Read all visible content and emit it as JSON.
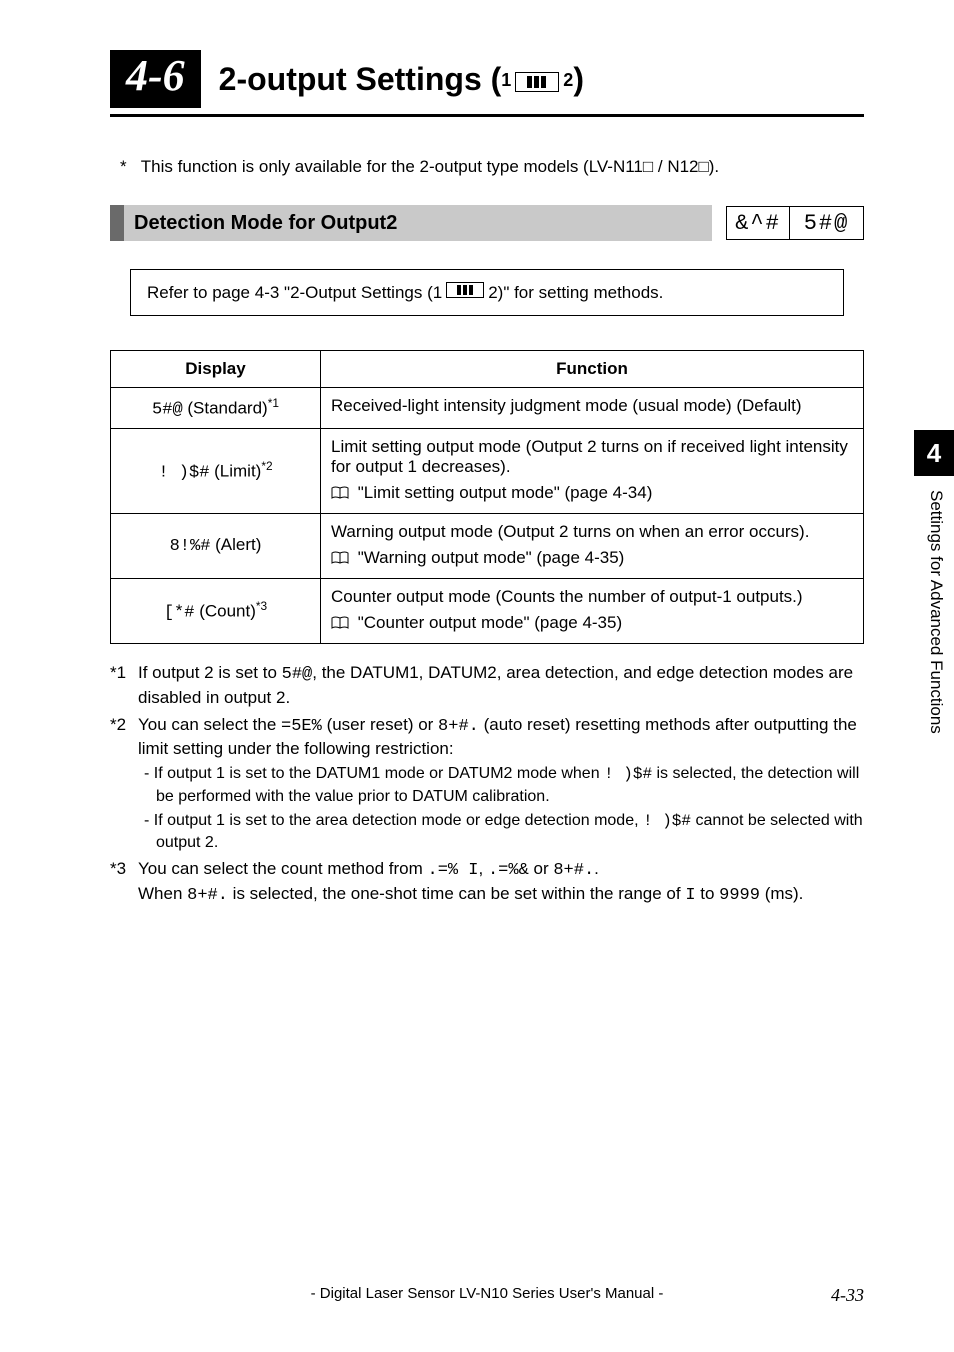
{
  "section": {
    "number": "4-6",
    "title_a": "2-output Settings (",
    "title_b": ")"
  },
  "bullets_label": {
    "left": "1",
    "right": "2"
  },
  "top_note": {
    "star": "*",
    "text": "This function is only available for the 2-output type models (LV-N11□ / N12□)."
  },
  "subheader": "Detection Mode for Output2",
  "seg": {
    "left": "&^#",
    "right": "5#@"
  },
  "refer": {
    "a": "Refer to page 4-3 \"2-Output Settings (1",
    "b": "2)\" for setting methods."
  },
  "table": {
    "head": {
      "display": "Display",
      "function": "Function"
    },
    "rows": [
      {
        "disp_code": "5#@",
        "disp_label": " (Standard)",
        "disp_sup": "*1",
        "func": "Received-light intensity judgment mode (usual mode) (Default)"
      },
      {
        "disp_code": "! )$#",
        "disp_label": " (Limit)",
        "disp_sup": "*2",
        "func_a": "Limit setting output mode (Output 2 turns on if received light intensity for output 1 decreases).",
        "func_b": "\"Limit setting output mode\" (page 4-34)"
      },
      {
        "disp_code": "8!%#",
        "disp_label": " (Alert)",
        "disp_sup": "",
        "func_a": "Warning output mode (Output 2 turns on when an error occurs).",
        "func_b": "\"Warning output mode\" (page 4-35)"
      },
      {
        "disp_code": "[*#",
        "disp_label": " (Count)",
        "disp_sup": "*3",
        "func_a": "Counter output mode (Counts the number of output-1 outputs.)",
        "func_b": "\"Counter output mode\" (page 4-35)"
      }
    ]
  },
  "footnotes": {
    "f1": {
      "tag": "*1",
      "a": "If output 2 is set to ",
      "code": "5#@",
      "b": ", the DATUM1, DATUM2, area detection, and edge detection modes are disabled in output 2."
    },
    "f2": {
      "tag": "*2",
      "a": "You can select the ",
      "code1": "=5E%",
      "mid1": " (user reset) or ",
      "code2": "8+#.",
      "b": " (auto reset) resetting methods after outputting the limit setting under the following restriction:",
      "dash1a": "- If output 1 is set to the DATUM1 mode or DATUM2 mode when ",
      "dash1code": "! )$#",
      "dash1b": " is selected, the detection will be performed with the value prior to DATUM calibration.",
      "dash2a": "- If output 1 is set to the area detection mode or edge detection mode, ",
      "dash2code": "! )$#",
      "dash2b": " cannot be selected with output 2."
    },
    "f3": {
      "tag": "*3",
      "a": "You can select the count method from ",
      "code1": ".=% I",
      "mid1": ", ",
      "code2": ".=%&",
      "mid2": " or ",
      "code3": "8+#.",
      "b": ".",
      "line2a": "When ",
      "line2code": "8+#.",
      "line2b": " is selected, the one-shot time can be set within the range of ",
      "line2num1": "I",
      "line2mid": " to ",
      "line2num2": "9999",
      "line2c": " (ms)."
    }
  },
  "side": {
    "num": "4",
    "text": "Settings for Advanced Functions"
  },
  "footer": {
    "center": "- Digital Laser Sensor LV-N10 Series User's Manual -",
    "page": "4-33"
  }
}
